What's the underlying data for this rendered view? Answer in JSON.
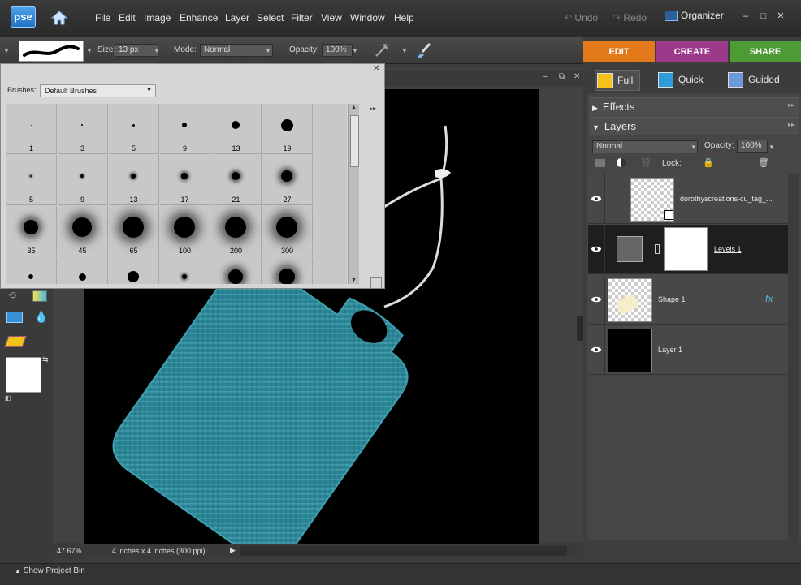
{
  "app": {
    "logo_text": "pse"
  },
  "menu": [
    "File",
    "Edit",
    "Image",
    "Enhance",
    "Layer",
    "Select",
    "Filter",
    "View",
    "Window",
    "Help"
  ],
  "history": {
    "undo": "Undo",
    "redo": "Redo"
  },
  "organizer": "Organizer",
  "options": {
    "size_label": "Size:",
    "size_value": "13 px",
    "mode_label": "Mode:",
    "mode_value": "Normal",
    "opacity_label": "Opacity:",
    "opacity_value": "100%"
  },
  "mode_tabs": [
    {
      "label": "EDIT",
      "color": "#e27a1c"
    },
    {
      "label": "CREATE",
      "color": "#9b3a8a"
    },
    {
      "label": "SHARE",
      "color": "#4e9a35"
    }
  ],
  "edit_subtabs": [
    "Full",
    "Quick",
    "Guided"
  ],
  "panels": {
    "effects": "Effects",
    "layers": "Layers"
  },
  "layers_panel": {
    "blend_mode": "Normal",
    "opacity_label": "Opacity:",
    "opacity_value": "100%",
    "lock_label": "Lock:",
    "layers": [
      {
        "name": "dorothyscreations-cu_tag_..."
      },
      {
        "name": "Levels 1"
      },
      {
        "name": "Shape 1",
        "fx": "fx"
      },
      {
        "name": "Layer 1"
      }
    ]
  },
  "brush_picker": {
    "label": "Brushes:",
    "set": "Default Brushes",
    "rows": [
      [
        "1",
        "3",
        "5",
        "9",
        "13",
        "19"
      ],
      [
        "5",
        "9",
        "13",
        "17",
        "21",
        "27"
      ],
      [
        "35",
        "45",
        "65",
        "100",
        "200",
        "300"
      ],
      [
        "",
        "",
        "",
        "",
        "",
        ""
      ]
    ]
  },
  "status": {
    "zoom": "47.67%",
    "doc_size": "4 inches x 4 inches (300 ppi)"
  },
  "project_bin": "Show Project Bin",
  "tag_color": "#2d8a9a"
}
